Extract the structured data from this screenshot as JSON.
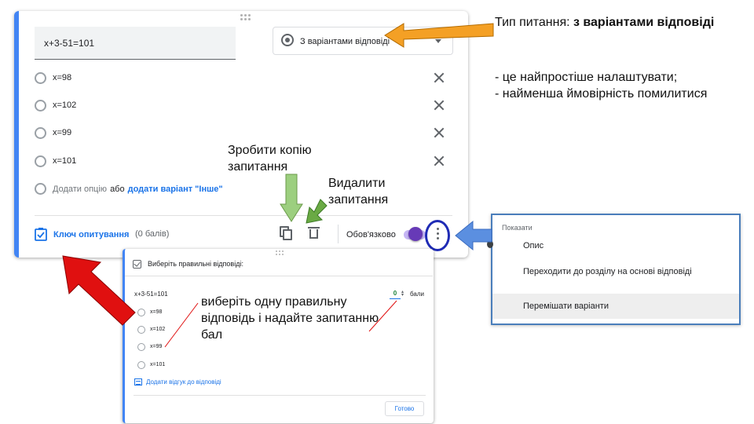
{
  "question_card": {
    "question_text": "x+3-51=101",
    "type_select": {
      "selected": "З варіантами відповіді",
      "icon": "radio-button-icon"
    },
    "options": [
      {
        "label": "x=98"
      },
      {
        "label": "x=102"
      },
      {
        "label": "x=99"
      },
      {
        "label": "x=101"
      }
    ],
    "add_option": "Додати опцію",
    "add_or": "або",
    "add_other": "додати варіант \"Інше\"",
    "answer_key_label": "Ключ опитування",
    "points_count": "(0 балів)",
    "required_label": "Обов'язково",
    "required_on": true
  },
  "annotations": {
    "type_prefix": "Тип питання:  ",
    "type_bold": "з варіантами відповіді",
    "bullet1": "- це найпростіше налаштувати;",
    "bullet2": "- найменша ймовірність помилитися",
    "copy_note": "Зробити копію запитання",
    "delete_note": "Видалити запитання",
    "answer_note": "виберіть одну правильну відповідь і надайте запитанню бал"
  },
  "answer_key_dialog": {
    "title": "Виберіть правильні відповіді:",
    "question": "x+3-51=101",
    "points_value": "0",
    "points_label": "бали",
    "options": [
      {
        "label": "x=98"
      },
      {
        "label": "x=102"
      },
      {
        "label": "x=99"
      },
      {
        "label": "x=101"
      }
    ],
    "feedback_link": "Додати відгук до відповіді",
    "done_button": "Готово"
  },
  "more_menu": {
    "header": "Показати",
    "items": [
      {
        "label": "Опис"
      },
      {
        "label": "Переходити до розділу на основі відповіді"
      },
      {
        "label": "Перемішати варіанти",
        "highlighted": true
      }
    ]
  },
  "colors": {
    "accent_blue": "#4285f4",
    "link_blue": "#1a73e8",
    "toggle_purple": "#673ab7",
    "arrow_orange": "#f4a025",
    "arrow_green": "#9ccf7f",
    "arrow_red": "#e01010",
    "arrow_blue": "#5b8fe0",
    "ring_navy": "#1f2bb5"
  }
}
